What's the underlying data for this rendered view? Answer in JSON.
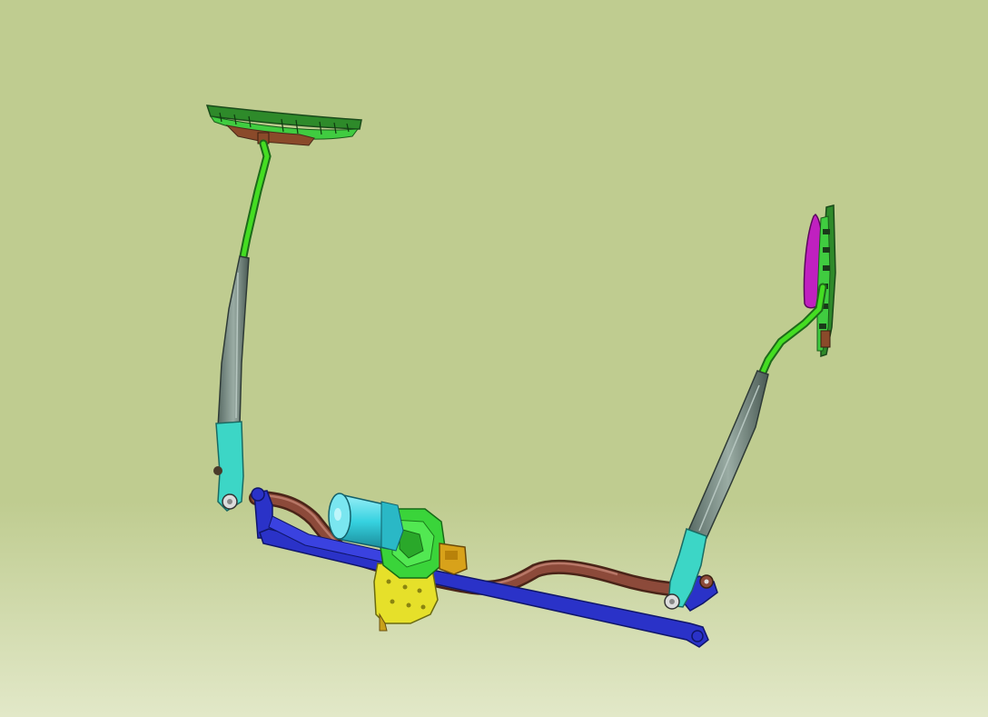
{
  "scene": {
    "subject": "wiper-linkage-assembly",
    "background": {
      "top": "#bfcc90",
      "bottom": "#e2e8c8"
    },
    "colors": {
      "blade_frame": "#2e8a2a",
      "blade_green": "#40cc40",
      "blade_brown": "#8a4a2a",
      "arm_green": "#44dd22",
      "arm_gray": "#7a8c84",
      "arm_gray_dark": "#4a5a54",
      "arm_cyan": "#3cd6c6",
      "linkage_blue": "#2a32c8",
      "tube_brown": "#8c4a3a",
      "motor_cyan": "#36d2e0",
      "gearbox_green": "#3ad43a",
      "bracket_yellow": "#e6e02a",
      "connector_orange": "#d8a21a",
      "pivot_white": "#dcdcdc",
      "magenta": "#c020c0"
    }
  }
}
